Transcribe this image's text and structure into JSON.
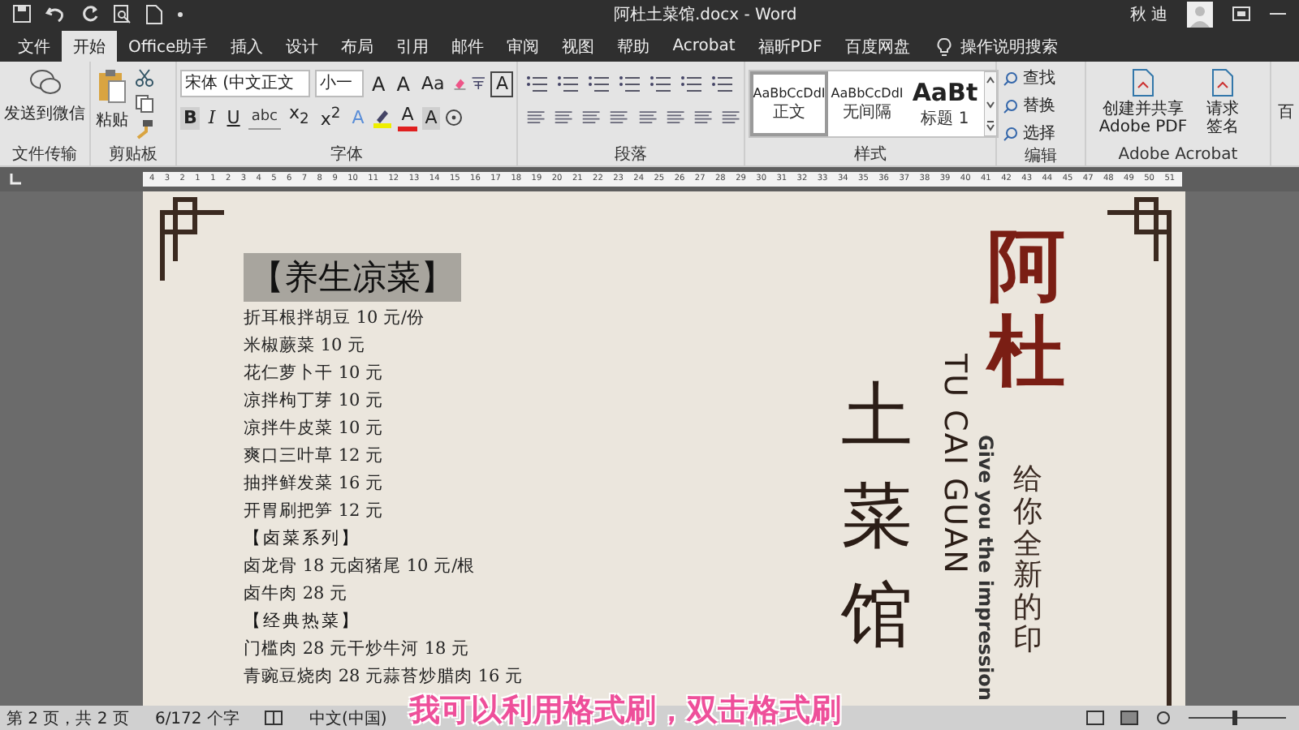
{
  "title_bar": {
    "title": "阿杜土菜馆.docx - Word",
    "user": "秋 迪"
  },
  "tabs": [
    {
      "label": "文件",
      "selected": false
    },
    {
      "label": "开始",
      "selected": true
    },
    {
      "label": "Office助手",
      "selected": false
    },
    {
      "label": "插入",
      "selected": false
    },
    {
      "label": "设计",
      "selected": false
    },
    {
      "label": "布局",
      "selected": false
    },
    {
      "label": "引用",
      "selected": false
    },
    {
      "label": "邮件",
      "selected": false
    },
    {
      "label": "审阅",
      "selected": false
    },
    {
      "label": "视图",
      "selected": false
    },
    {
      "label": "帮助",
      "selected": false
    },
    {
      "label": "Acrobat",
      "selected": false
    },
    {
      "label": "福昕PDF",
      "selected": false
    },
    {
      "label": "百度网盘",
      "selected": false
    }
  ],
  "tell_me": "操作说明搜索",
  "file_transfer": {
    "button": "发送到微信",
    "group": "文件传输"
  },
  "clipboard": {
    "paste": "粘贴",
    "group": "剪贴板"
  },
  "font": {
    "name": "宋体 (中文正文",
    "size": "小一",
    "group": "字体",
    "row1": [
      {
        "kind": "grow",
        "label": "A"
      },
      {
        "kind": "shrink",
        "label": "A"
      },
      {
        "kind": "text",
        "label": "Aa"
      },
      {
        "kind": "eraser"
      },
      {
        "kind": "pinyin"
      },
      {
        "kind": "boxed",
        "label": "A"
      }
    ],
    "row2": [
      {
        "kind": "bold",
        "label": "B"
      },
      {
        "kind": "italic",
        "label": "I"
      },
      {
        "kind": "underline",
        "label": "U"
      },
      {
        "kind": "strike",
        "label": "abc"
      },
      {
        "kind": "text",
        "label": "x$_{2}$"
      },
      {
        "kind": "text",
        "label": "x$^{2}$"
      },
      {
        "kind": "outline",
        "label": "A"
      },
      {
        "kind": "highlight"
      },
      {
        "kind": "color",
        "label": "A"
      },
      {
        "kind": "shaded",
        "label": "A"
      },
      {
        "kind": "circle"
      }
    ]
  },
  "paragraph": {
    "group": "段落"
  },
  "styles": {
    "group": "样式",
    "items": [
      {
        "sample": "AaBbCcDdI",
        "name": "正文",
        "selected": true,
        "kind": "body"
      },
      {
        "sample": "AaBbCcDdI",
        "name": "无间隔",
        "selected": false,
        "kind": "body"
      },
      {
        "sample": "AaBt",
        "name": "标题 1",
        "selected": false,
        "kind": "heading"
      }
    ]
  },
  "editing": {
    "group": "编辑",
    "items": [
      "查找",
      "替换",
      "选择"
    ]
  },
  "acrobat": {
    "group": "Adobe Acrobat",
    "items": [
      "创建并共享 Adobe PDF",
      "请求签名"
    ],
    "cut_label": "百"
  },
  "ruler": {
    "labels": [
      "4",
      "3",
      "2",
      "1",
      "1",
      "2",
      "3",
      "4",
      "5",
      "6",
      "7",
      "8",
      "9",
      "10",
      "11",
      "12",
      "13",
      "14",
      "15",
      "16",
      "17",
      "18",
      "19",
      "20",
      "21",
      "22",
      "23",
      "24",
      "25",
      "26",
      "27",
      "28",
      "29",
      "30",
      "31",
      "32",
      "33",
      "34",
      "35",
      "36",
      "37",
      "38",
      "39",
      "40",
      "41",
      "42",
      "43",
      "44",
      "45",
      "47",
      "48",
      "49",
      "50",
      "51"
    ]
  },
  "document": {
    "heading": "【养生凉菜】",
    "lines": [
      {
        "kind": "item",
        "text": "折耳根拌胡豆 10 元/份"
      },
      {
        "kind": "item",
        "text": "米椒蕨菜 10 元"
      },
      {
        "kind": "item",
        "text": "花仁萝卜干 10 元"
      },
      {
        "kind": "item",
        "text": "凉拌枸丁芽 10 元"
      },
      {
        "kind": "item",
        "text": "凉拌牛皮菜 10 元"
      },
      {
        "kind": "item",
        "text": "爽口三叶草 12 元"
      },
      {
        "kind": "item",
        "text": "抽拌鲜发菜 16 元"
      },
      {
        "kind": "item",
        "text": "开胃刷把笋 12 元"
      },
      {
        "kind": "section",
        "text": "【卤菜系列】"
      },
      {
        "kind": "item",
        "text": "卤龙骨 18 元卤猪尾 10 元/根"
      },
      {
        "kind": "item",
        "text": "卤牛肉 28 元"
      },
      {
        "kind": "section",
        "text": "【经典热菜】"
      },
      {
        "kind": "item",
        "text": "门槛肉 28 元干炒牛河 18 元"
      },
      {
        "kind": "item",
        "text": "青豌豆烧肉 28 元蒜苔炒腊肉 16 元"
      }
    ],
    "logo": {
      "name_red": "阿杜",
      "name_dark": "土菜馆",
      "pinyin": "TU CAI GUAN",
      "slogan_en": "Give you the impression",
      "slogan_cn": "给你全新的印"
    }
  },
  "status_bar": {
    "page": "第 2 页，共 2 页",
    "words": "6/172 个字",
    "language": "中文(中国)",
    "zoom": {
      "level": 0.45
    }
  },
  "caption": "我可以利用格式刷，双击格式刷"
}
